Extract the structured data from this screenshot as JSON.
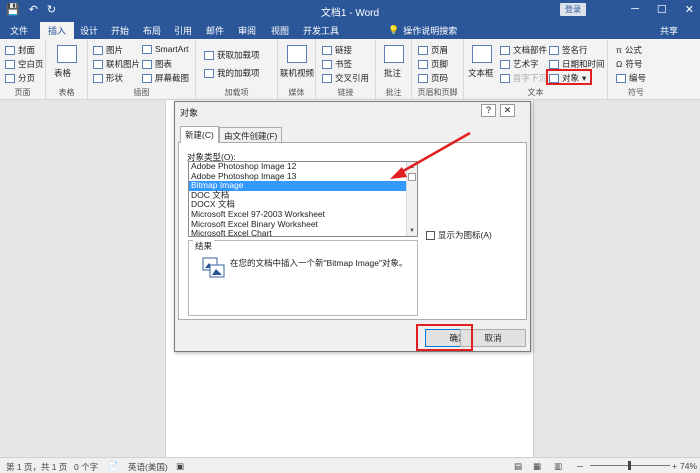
{
  "titlebar": {
    "title": "文档1 - Word",
    "login": "登录",
    "qat_save": "💾",
    "qat_undo": "↶",
    "qat_redo": "↻",
    "minimize": "─",
    "restore": "☐",
    "close": "✕"
  },
  "tabs": {
    "file": "文件",
    "insert": "插入",
    "design": "设计",
    "home": "开始",
    "layout": "布局",
    "references": "引用",
    "mailings": "邮件",
    "review": "审阅",
    "view": "视图",
    "developer": "开发工具",
    "tellme": "操作说明搜索",
    "share": "共享"
  },
  "ribbon": {
    "pages": {
      "cover": "封面",
      "blank": "空白页",
      "break": "分页",
      "label": "页面"
    },
    "tables": {
      "table": "表格",
      "label": "表格"
    },
    "illustrations": {
      "pictures": "图片",
      "online_pictures": "联机图片",
      "shapes": "形状",
      "smartart": "SmartArt",
      "chart": "图表",
      "screenshot": "屏幕截图",
      "label": "插图"
    },
    "addins": {
      "get": "获取加载项",
      "my": "我的加载项",
      "label": "加载项"
    },
    "media": {
      "video": "联机视频",
      "label": "媒体"
    },
    "links": {
      "link": "链接",
      "bookmark": "书签",
      "crossref": "交叉引用",
      "label": "链接"
    },
    "comments": {
      "comment": "批注",
      "label": "批注"
    },
    "header_footer": {
      "header": "页眉",
      "footer": "页脚",
      "page_number": "页码",
      "label": "页眉和页脚"
    },
    "text": {
      "textbox": "文本框",
      "quickparts": "文档部件",
      "wordart": "艺术字",
      "dropcap": "首字下沉",
      "signature": "签名行",
      "datetime": "日期和时间",
      "object": "对象",
      "label": "文本"
    },
    "symbols": {
      "equation": "公式",
      "symbol": "符号",
      "number": "编号",
      "label": "符号"
    }
  },
  "dialog": {
    "title": "对象",
    "help": "?",
    "close": "✕",
    "tab_new": "新建(C)",
    "tab_file": "由文件创建(F)",
    "objtype_label": "对象类型(O):",
    "items": [
      "Adobe Photoshop Image 12",
      "Adobe Photoshop Image 13",
      "Bitmap Image",
      "DOC 文档",
      "DOCX 文档",
      "Microsoft Excel 97-2003 Worksheet",
      "Microsoft Excel Binary Worksheet",
      "Microsoft Excel Chart"
    ],
    "selected_index": 2,
    "show_as_icon": "显示为图标(A)",
    "result_label": "结果",
    "result_text": "在您的文档中插入一个新\"Bitmap Image\"对象。",
    "ok": "确定",
    "cancel": "取消"
  },
  "statusbar": {
    "pages": "第 1 页，共 1 页",
    "words": "0 个字",
    "lang": "英语(美国)",
    "zoom": "74%",
    "minus": "─",
    "plus": "+"
  },
  "colors": {
    "accent": "#2b579a",
    "highlight": "#e02020",
    "selection": "#3399ff"
  }
}
